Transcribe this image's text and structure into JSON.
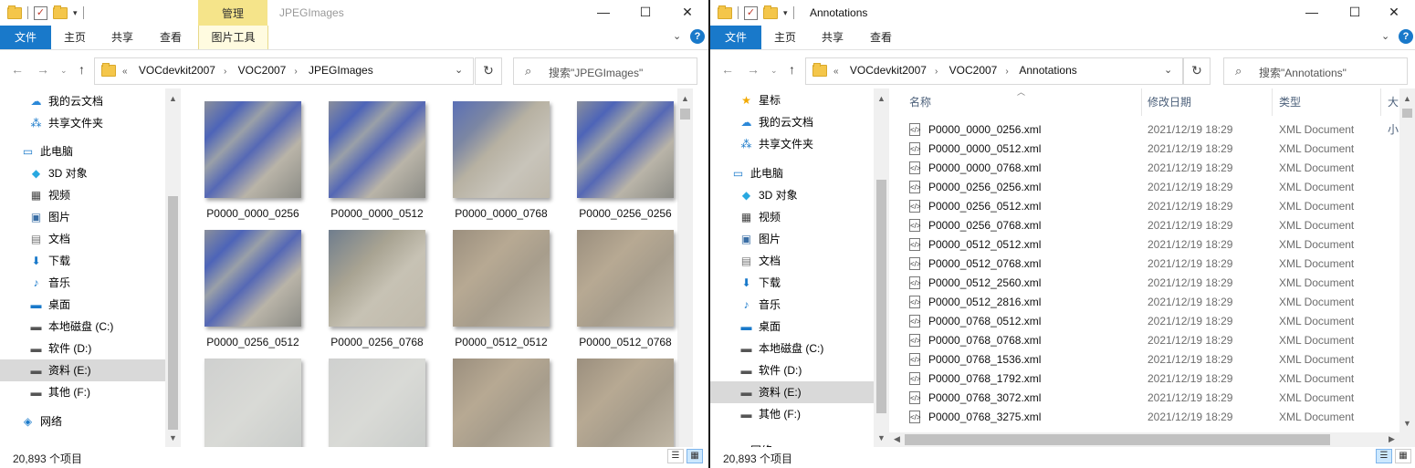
{
  "left": {
    "title": "JPEGImages",
    "context_tab": "管理",
    "tabs": [
      "文件",
      "主页",
      "共享",
      "查看",
      "图片工具"
    ],
    "breadcrumb": [
      "VOCdevkit2007",
      "VOC2007",
      "JPEGImages"
    ],
    "search_placeholder": "搜索\"JPEGImages\"",
    "nav": [
      {
        "label": "我的云文档",
        "icon": "cloud-icon"
      },
      {
        "label": "共享文件夹",
        "icon": "share-icon"
      },
      {
        "label": "此电脑",
        "icon": "pc-icon"
      },
      {
        "label": "3D 对象",
        "icon": "cube-icon"
      },
      {
        "label": "视频",
        "icon": "video-icon"
      },
      {
        "label": "图片",
        "icon": "picture-icon"
      },
      {
        "label": "文档",
        "icon": "document-icon"
      },
      {
        "label": "下载",
        "icon": "download-icon"
      },
      {
        "label": "音乐",
        "icon": "music-icon"
      },
      {
        "label": "桌面",
        "icon": "desktop-icon"
      },
      {
        "label": "本地磁盘 (C:)",
        "icon": "drive-icon"
      },
      {
        "label": "软件 (D:)",
        "icon": "drive-icon"
      },
      {
        "label": "资料 (E:)",
        "icon": "drive-icon",
        "selected": true
      },
      {
        "label": "其他 (F:)",
        "icon": "drive-icon"
      },
      {
        "label": "网络",
        "icon": "network-icon"
      }
    ],
    "thumbnails": [
      {
        "name": "P0000_0000_0256",
        "tone": "roofs"
      },
      {
        "name": "P0000_0000_0512",
        "tone": "roofs"
      },
      {
        "name": "P0000_0000_0768",
        "tone": "roofs-road"
      },
      {
        "name": "P0000_0256_0256",
        "tone": "roofs"
      },
      {
        "name": "P0000_0256_0512",
        "tone": "roofs"
      },
      {
        "name": "P0000_0256_0768",
        "tone": "field"
      },
      {
        "name": "P0000_0512_0512",
        "tone": "dirt"
      },
      {
        "name": "P0000_0512_0768",
        "tone": "dirt"
      },
      {
        "name": "",
        "tone": "pale"
      },
      {
        "name": "",
        "tone": "pale"
      },
      {
        "name": "",
        "tone": "dirt"
      },
      {
        "name": "",
        "tone": "dirt"
      }
    ],
    "status": "20,893 个项目"
  },
  "right": {
    "title": "Annotations",
    "tabs": [
      "文件",
      "主页",
      "共享",
      "查看"
    ],
    "breadcrumb": [
      "VOCdevkit2007",
      "VOC2007",
      "Annotations"
    ],
    "search_placeholder": "搜索\"Annotations\"",
    "nav": [
      {
        "label": "星标",
        "icon": "star-icon"
      },
      {
        "label": "我的云文档",
        "icon": "cloud-icon"
      },
      {
        "label": "共享文件夹",
        "icon": "share-icon"
      },
      {
        "label": "此电脑",
        "icon": "pc-icon"
      },
      {
        "label": "3D 对象",
        "icon": "cube-icon"
      },
      {
        "label": "视频",
        "icon": "video-icon"
      },
      {
        "label": "图片",
        "icon": "picture-icon"
      },
      {
        "label": "文档",
        "icon": "document-icon"
      },
      {
        "label": "下载",
        "icon": "download-icon"
      },
      {
        "label": "音乐",
        "icon": "music-icon"
      },
      {
        "label": "桌面",
        "icon": "desktop-icon"
      },
      {
        "label": "本地磁盘 (C:)",
        "icon": "drive-icon"
      },
      {
        "label": "软件 (D:)",
        "icon": "drive-icon"
      },
      {
        "label": "资料 (E:)",
        "icon": "drive-icon",
        "selected": true
      },
      {
        "label": "其他 (F:)",
        "icon": "drive-icon"
      },
      {
        "label": "网络",
        "icon": "network-icon"
      }
    ],
    "columns": [
      "名称",
      "修改日期",
      "类型",
      "大小"
    ],
    "files": [
      {
        "name": "P0000_0000_0256.xml",
        "date": "2021/12/19 18:29",
        "type": "XML Document"
      },
      {
        "name": "P0000_0000_0512.xml",
        "date": "2021/12/19 18:29",
        "type": "XML Document"
      },
      {
        "name": "P0000_0000_0768.xml",
        "date": "2021/12/19 18:29",
        "type": "XML Document"
      },
      {
        "name": "P0000_0256_0256.xml",
        "date": "2021/12/19 18:29",
        "type": "XML Document"
      },
      {
        "name": "P0000_0256_0512.xml",
        "date": "2021/12/19 18:29",
        "type": "XML Document"
      },
      {
        "name": "P0000_0256_0768.xml",
        "date": "2021/12/19 18:29",
        "type": "XML Document"
      },
      {
        "name": "P0000_0512_0512.xml",
        "date": "2021/12/19 18:29",
        "type": "XML Document"
      },
      {
        "name": "P0000_0512_0768.xml",
        "date": "2021/12/19 18:29",
        "type": "XML Document"
      },
      {
        "name": "P0000_0512_2560.xml",
        "date": "2021/12/19 18:29",
        "type": "XML Document"
      },
      {
        "name": "P0000_0512_2816.xml",
        "date": "2021/12/19 18:29",
        "type": "XML Document"
      },
      {
        "name": "P0000_0768_0512.xml",
        "date": "2021/12/19 18:29",
        "type": "XML Document"
      },
      {
        "name": "P0000_0768_0768.xml",
        "date": "2021/12/19 18:29",
        "type": "XML Document"
      },
      {
        "name": "P0000_0768_1536.xml",
        "date": "2021/12/19 18:29",
        "type": "XML Document"
      },
      {
        "name": "P0000_0768_1792.xml",
        "date": "2021/12/19 18:29",
        "type": "XML Document"
      },
      {
        "name": "P0000_0768_3072.xml",
        "date": "2021/12/19 18:29",
        "type": "XML Document"
      },
      {
        "name": "P0000_0768_3275.xml",
        "date": "2021/12/19 18:29",
        "type": "XML Document"
      }
    ],
    "status": "20,893 个项目"
  },
  "colors": {
    "accent": "#1979ca",
    "context_tab": "#f5e48a",
    "selected": "#d9d9d9"
  }
}
